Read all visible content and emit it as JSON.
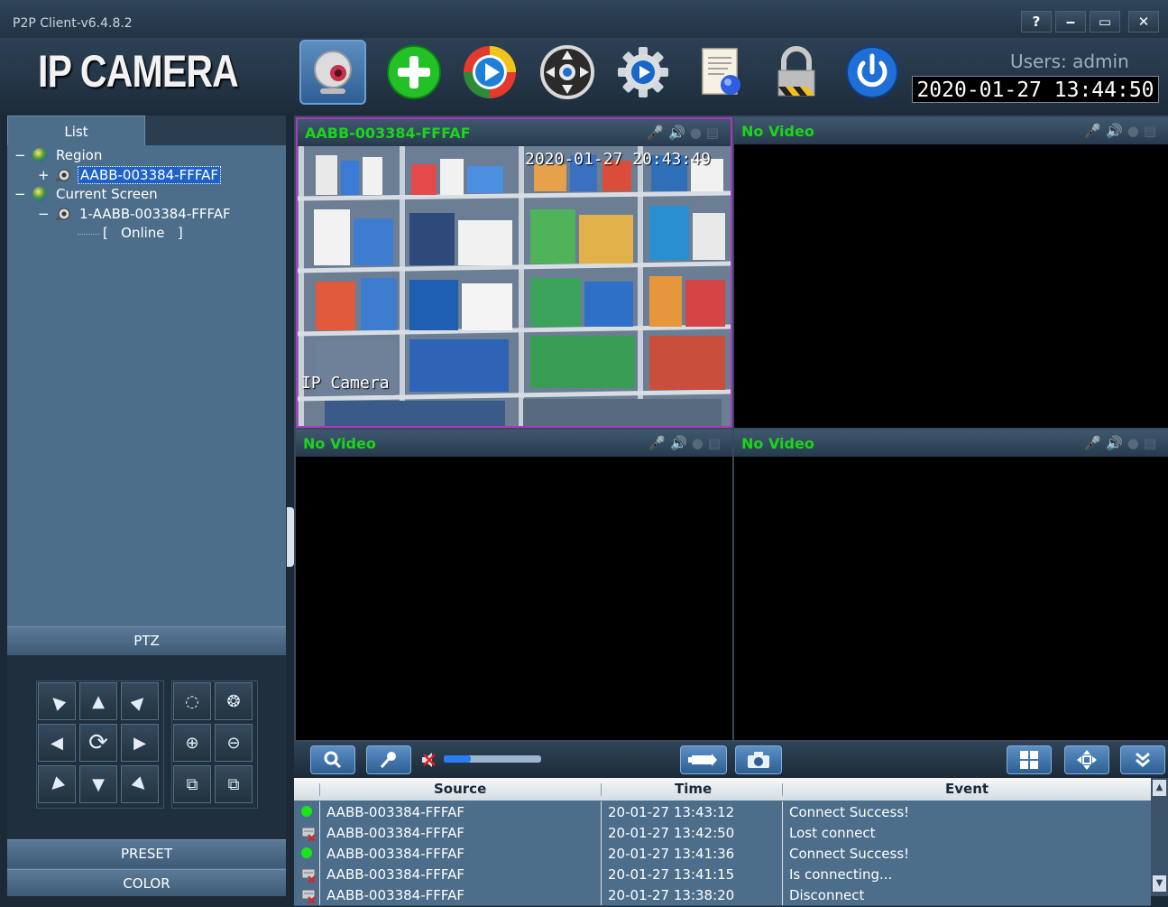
{
  "window": {
    "title": "P2P Client-v6.4.8.2",
    "help_glyph": "?",
    "min_glyph": "‒",
    "max_glyph": "▭",
    "close_glyph": "✕"
  },
  "header": {
    "logo_text": "IP CAMERA",
    "toolbar": [
      {
        "name": "camera-icon"
      },
      {
        "name": "add-device-icon"
      },
      {
        "name": "playback-icon"
      },
      {
        "name": "ptz-control-icon"
      },
      {
        "name": "settings-gear-icon"
      },
      {
        "name": "log-document-icon"
      },
      {
        "name": "lock-icon"
      },
      {
        "name": "power-icon"
      }
    ],
    "users_text": "Users: admin",
    "datetime": "2020-01-27 13:44:50"
  },
  "left": {
    "tab_label": "List",
    "tree": {
      "region_label": "Region",
      "region_device": "AABB-003384-FFFAF",
      "current_screen_label": "Current Screen",
      "screen_device": "1-AABB-003384-FFFAF",
      "status_text": "[   Online   ]"
    },
    "ptz_label": "PTZ",
    "preset_label": "PRESET",
    "color_label": "COLOR"
  },
  "video": {
    "panes": [
      {
        "title": "AABB-003384-FFFAF",
        "osd_time": "2020-01-27 20:43:49",
        "osd_label": "IP Camera"
      },
      {
        "title": "No Video"
      },
      {
        "title": "No Video"
      },
      {
        "title": "No Video"
      }
    ],
    "pane_icons": [
      "microphone-icon",
      "speaker-icon",
      "record-icon",
      "snapshot-icon"
    ]
  },
  "controls": {
    "volume_level": 0.28,
    "icons": [
      "zoom-icon",
      "microphone-icon",
      "mute-speaker-icon",
      "record-camera-icon",
      "snapshot-icon",
      "layout-grid-icon",
      "fullscreen-icon",
      "collapse-icon"
    ]
  },
  "log": {
    "columns": [
      "Source",
      "Time",
      "Event"
    ],
    "rows": [
      {
        "status": "online",
        "source": "AABB-003384-FFFAF",
        "time": "20-01-27 13:43:12",
        "event": "Connect Success!"
      },
      {
        "status": "offline",
        "source": "AABB-003384-FFFAF",
        "time": "20-01-27 13:42:50",
        "event": "Lost connect"
      },
      {
        "status": "online",
        "source": "AABB-003384-FFFAF",
        "time": "20-01-27 13:41:36",
        "event": "Connect Success!"
      },
      {
        "status": "offline",
        "source": "AABB-003384-FFFAF",
        "time": "20-01-27 13:41:15",
        "event": "Is connecting..."
      },
      {
        "status": "offline",
        "source": "AABB-003384-FFFAF",
        "time": "20-01-27 13:38:20",
        "event": "Disconnect"
      }
    ]
  },
  "colors": {
    "accent_green": "#1bd51b",
    "panel_blue": "#4d6e8b",
    "selected_border": "#b038c0"
  }
}
